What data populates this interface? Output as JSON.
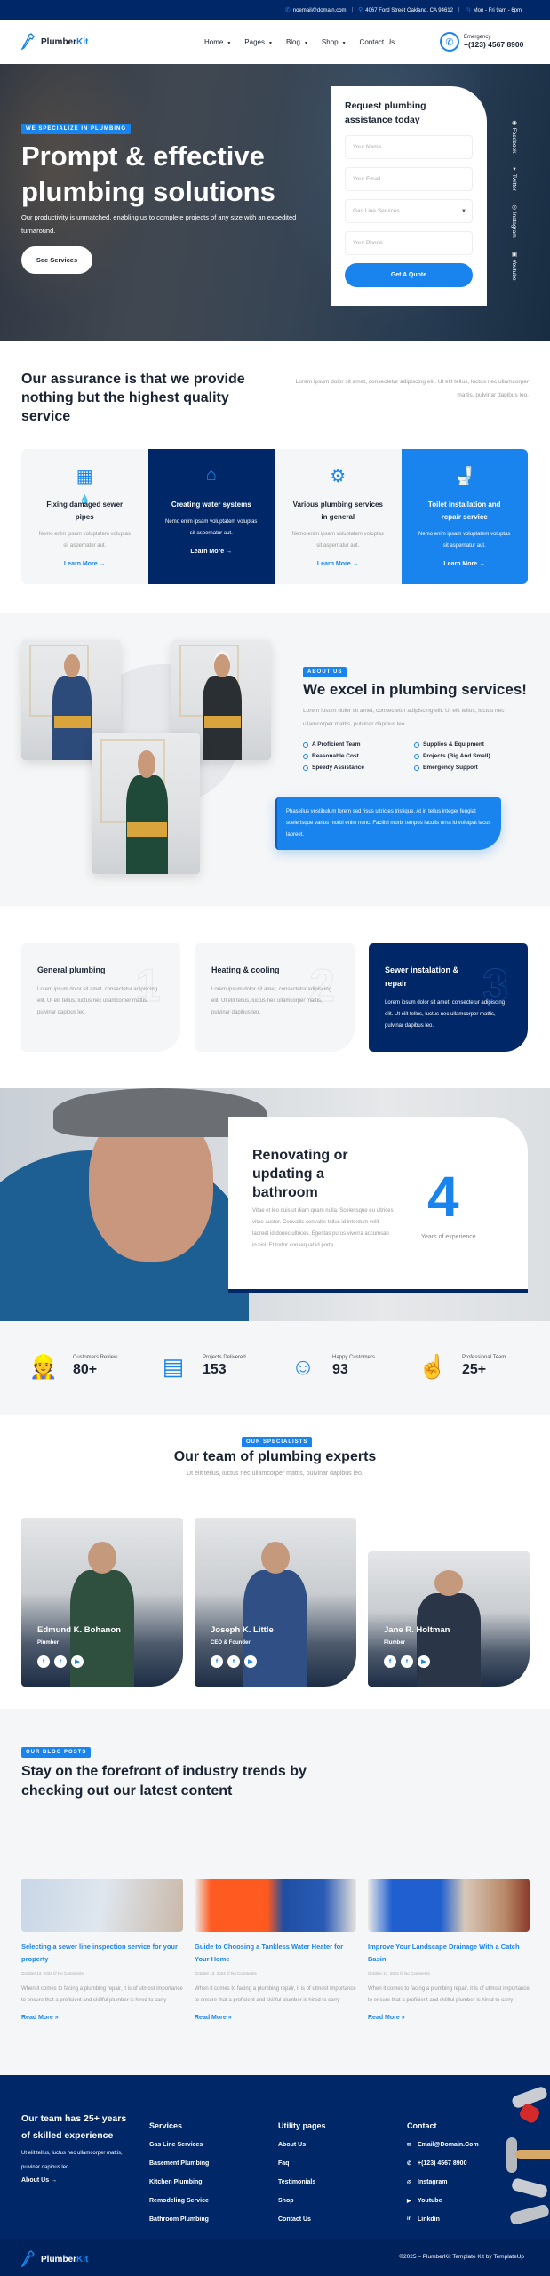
{
  "topbar": {
    "email": "noemail@domain.com",
    "address": "4067 Ford Street Oakland, CA 94612",
    "hours": "Mon - Fri 9am - 6pm"
  },
  "header": {
    "logo_main": "Plumber",
    "logo_accent": "Kit",
    "nav": [
      "Home",
      "Pages",
      "Blog",
      "Shop",
      "Contact Us"
    ],
    "emergency_label": "Emergency",
    "emergency_phone": "+(123) 4567 8900"
  },
  "hero": {
    "badge": "WE SPECIALIZE IN PLUMBING",
    "title": "Prompt & effective plumbing solutions",
    "subtitle": "Our productivity is unmatched, enabling us to complete projects of any size with an expedited turnaround.",
    "button": "See Services",
    "form": {
      "title": "Request plumbing assistance today",
      "name_placeholder": "Your Name",
      "email_placeholder": "Your Email",
      "service_selected": "Gas Line Services",
      "phone_placeholder": "Your Phone",
      "submit": "Get A Quote"
    },
    "social": [
      "Facebook",
      "Twitter",
      "Instagram",
      "Youtube"
    ]
  },
  "assurance": {
    "title": "Our assurance is that we provide nothing but the highest quality service",
    "text": "Lorem ipsum dolor sit amet, consectetur adipiscing elit. Ut elit tellus, luctus nec ullamcorper mattis, pulvinar dapibus leo.",
    "cards": [
      {
        "icon": "pipe-leak-icon",
        "title": "Fixing damaged sewer pipes",
        "text": "Nemo enim ipsam voluptatem voluptas sit aspernatur aut.",
        "link": "Learn More"
      },
      {
        "icon": "water-system-icon",
        "title": "Creating water systems",
        "text": "Nemo enim ipsam voluptatem voluptas sit aspernatur aut.",
        "link": "Learn More"
      },
      {
        "icon": "gear-drop-icon",
        "title": "Various plumbing services in general",
        "text": "Nemo enim ipsam voluptatem voluptas sit aspernatur aut.",
        "link": "Learn More"
      },
      {
        "icon": "toilet-icon",
        "title": "Toilet installation and repair service",
        "text": "Nemo enim ipsam voluptatem voluptas sit aspernatur aut.",
        "link": "Learn More"
      }
    ]
  },
  "about": {
    "badge": "ABOUT US",
    "title": "We excel in plumbing services!",
    "text": "Lorem ipsum dolor sit amet, consectetur adipiscing elit. Ut elit tellus, luctus nec ullamcorper mattis, pulvinar dapibus leo.",
    "features": [
      "A Proficient Team",
      "Supplies & Equipment",
      "Reasonable Cost",
      "Projects (Big And Small)",
      "Speedy Assistance",
      "Emergency Support"
    ],
    "quote": "Phasellus vestibulum lorem sed risus ultricies tristique. At in tellus integer feugiat scelerisque varius morbi enim nunc. Facilisi morbi tempus iaculis urna id volutpat lacus laoreet."
  },
  "steps": [
    {
      "num": "1",
      "title": "General plumbing",
      "text": "Lorem ipsum dolor sit amet, consectetur adipiscing elit. Ut elit tellus, luctus nec ullamcorper mattis, pulvinar dapibus leo."
    },
    {
      "num": "2",
      "title": "Heating & cooling",
      "text": "Lorem ipsum dolor sit amet, consectetur adipiscing elit. Ut elit tellus, luctus nec ullamcorper mattis, pulvinar dapibus leo."
    },
    {
      "num": "3",
      "title": "Sewer instalation & repair",
      "text": "Lorem ipsum dolor sit amet, consectetur adipiscing elit. Ut elit tellus, luctus nec ullamcorper mattis, pulvinar dapibus leo."
    }
  ],
  "renovation": {
    "title": "Renovating or updating a bathroom",
    "text": "Vitae et leo duis ut diam quam nulla. Scelerisque eu ultrices vitae auctor. Convallis convallis tellus id interdum velit laoreet id donec ultrices. Egestas purus viverra accumsan in nisl. Et tortor consequat id porta.",
    "years": "4",
    "years_label": "Years of experience"
  },
  "stats": [
    {
      "icon": "plumber-icon",
      "label": "Customers Review",
      "value": "80+"
    },
    {
      "icon": "tablet-icon",
      "label": "Projects Delivered",
      "value": "153"
    },
    {
      "icon": "support-agent-icon",
      "label": "Happy Customers",
      "value": "93"
    },
    {
      "icon": "phone-touch-icon",
      "label": "Professional Team",
      "value": "25+"
    }
  ],
  "team": {
    "badge": "OUR SPECIALISTS",
    "title": "Our team of plumbing experts",
    "text": "Ut elit tellus, luctus nec ullamcorper mattis, pulvinar dapibus leo.",
    "members": [
      {
        "name": "Edmund K. Bohanon",
        "role": "Plumber"
      },
      {
        "name": "Joseph K. Little",
        "role": "CEO & Founder"
      },
      {
        "name": "Jane R. Holtman",
        "role": "Plumber"
      }
    ]
  },
  "blog": {
    "badge": "OUR BLOG POSTS",
    "title": "Stay on the forefront of industry trends by checking out our latest content",
    "posts": [
      {
        "title": "Selecting a sewer line inspection service for your property",
        "meta": "October 13, 2024 /// No Comments",
        "text": "When it comes to facing a plumbing repair, it is of utmost importance to ensure that a proficient and skillful plumber is hired to carry",
        "link": "Read More »"
      },
      {
        "title": "Guide to Choosing a Tankless Water Heater for Your Home",
        "meta": "October 13, 2024 /// No Comments",
        "text": "When it comes to facing a plumbing repair, it is of utmost importance to ensure that a proficient and skillful plumber is hired to carry",
        "link": "Read More »"
      },
      {
        "title": "Improve Your Landscape Drainage With a Catch Basin",
        "meta": "October 13, 2024 /// No Comments",
        "text": "When it comes to facing a plumbing repair, it is of utmost importance to ensure that a proficient and skillful plumber is hired to carry",
        "link": "Read More »"
      }
    ]
  },
  "footer": {
    "headline": "Our team has 25+ years of skilled experience",
    "text": "Ut elit tellus, luctus nec ullamcorper mattis, pulvinar dapibus leo.",
    "about_link": "About Us",
    "services_title": "Services",
    "services": [
      "Gas Line Services",
      "Basement Plumbing",
      "Kitchen Plumbing",
      "Remodeling Service",
      "Bathroom Plumbing"
    ],
    "utility_title": "Utility pages",
    "utility": [
      "About Us",
      "Faq",
      "Testimonials",
      "Shop",
      "Contact Us"
    ],
    "contact_title": "Contact",
    "contact": [
      "Email@Domain.Com",
      "+(123) 4567 8900",
      "Instagram",
      "Youtube",
      "Linkdin"
    ],
    "copyright": "©2025 – PlumberKit Template Kit by TemplateUp"
  },
  "colors": {
    "primary": "#1a84ee",
    "navy": "#002868",
    "text": "#1b2433",
    "muted": "#999999",
    "bg": "#f5f6f7"
  }
}
